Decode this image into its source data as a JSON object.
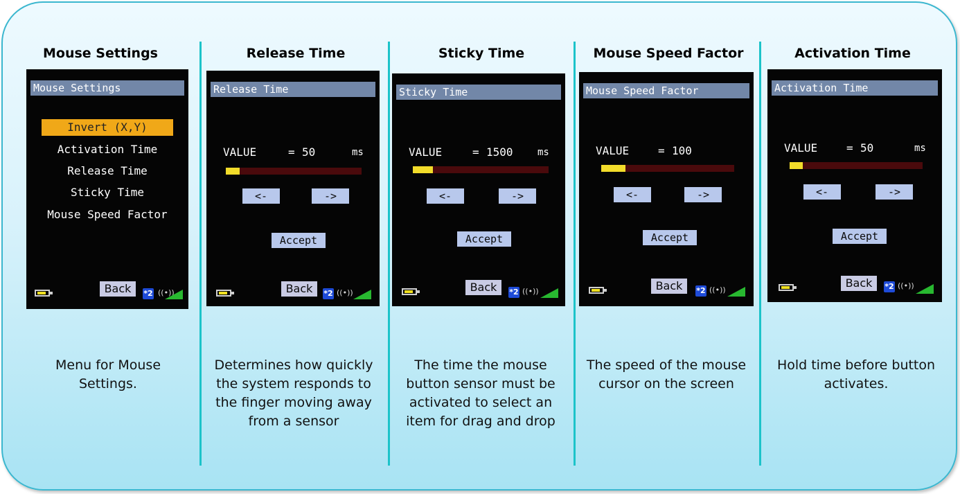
{
  "columns": [
    {
      "heading": "Mouse Settings",
      "screen_title": "Mouse Settings",
      "menu": [
        "Invert (X,Y)",
        "Activation Time",
        "Release Time",
        "Sticky Time",
        "Mouse Speed Factor"
      ],
      "selected_index": 0,
      "back_label": "Back",
      "bt_label": "*2",
      "description": "Menu for Mouse Settings."
    },
    {
      "heading": "Release Time",
      "screen_title": "Release Time",
      "value_label": "VALUE",
      "value_eq": "=",
      "value_num": "50",
      "value_unit": "ms",
      "slider_fraction": 0.1,
      "left_btn": "<-",
      "right_btn": "->",
      "accept_label": "Accept",
      "back_label": "Back",
      "bt_label": "*2",
      "description": "Determines how quickly the system responds to the finger moving away from a sensor"
    },
    {
      "heading": "Sticky Time",
      "screen_title": "Sticky Time",
      "value_label": "VALUE",
      "value_eq": "=",
      "value_num": "1500",
      "value_unit": "ms",
      "slider_fraction": 0.15,
      "left_btn": "<-",
      "right_btn": "->",
      "accept_label": "Accept",
      "back_label": "Back",
      "bt_label": "*2",
      "description": "The time the mouse button sensor must be activated to select an item for drag and drop"
    },
    {
      "heading": "Mouse Speed Factor",
      "screen_title": "Mouse Speed Factor",
      "value_label": "VALUE",
      "value_eq": "=",
      "value_num": "100",
      "value_unit": "",
      "slider_fraction": 0.18,
      "left_btn": "<-",
      "right_btn": "->",
      "accept_label": "Accept",
      "back_label": "Back",
      "bt_label": "*2",
      "description": "The speed of the mouse cursor on the screen"
    },
    {
      "heading": "Activation Time",
      "screen_title": "Activation Time",
      "value_label": "VALUE",
      "value_eq": "=",
      "value_num": "50",
      "value_unit": "ms",
      "slider_fraction": 0.1,
      "left_btn": "<-",
      "right_btn": "->",
      "accept_label": "Accept",
      "back_label": "Back",
      "bt_label": "*2",
      "description": "Hold time before button activates."
    }
  ],
  "colors": {
    "border": "#3bb7cf",
    "divider": "#1cc3c9",
    "screen_title_bg": "#7287a8",
    "menu_selected_bg": "#f0a818",
    "slider_fill": "#f2dc2a",
    "slider_track": "#4a0a0c",
    "button_bg": "#b8c8ec",
    "signal": "#28b830"
  },
  "icons": [
    "battery-icon",
    "bluetooth-icon",
    "wireless-icon",
    "signal-strength-icon"
  ]
}
